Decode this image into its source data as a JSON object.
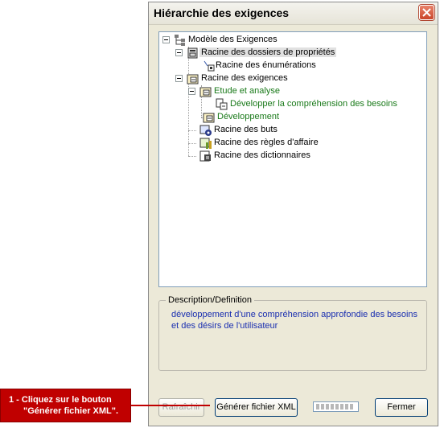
{
  "window": {
    "title": "Hiérarchie des exigences"
  },
  "tree": {
    "root": "Modèle des Exigences",
    "items": [
      "Racine des dossiers de propriétés",
      "Racine des énumérations",
      "Racine des exigences",
      "Etude et analyse",
      "Développer la compréhension des besoins",
      "Développement",
      "Racine des buts",
      "Racine des règles d'affaire",
      "Racine des dictionnaires"
    ]
  },
  "description": {
    "legend": "Description/Definition",
    "line1": "développement d'une compréhension approfondie des besoins",
    "line2": "et des désirs de l'utilisateur"
  },
  "buttons": {
    "refresh": "Rafraîchir",
    "generate": "Générer fichier XML",
    "close": "Fermer"
  },
  "callout": {
    "line1": "1 - Cliquez sur le bouton",
    "line2": "\"Générer fichier XML\"."
  },
  "colors": {
    "callout": "#c00000",
    "description_text": "#1a2fb0",
    "green_node": "#1a7a1a"
  }
}
